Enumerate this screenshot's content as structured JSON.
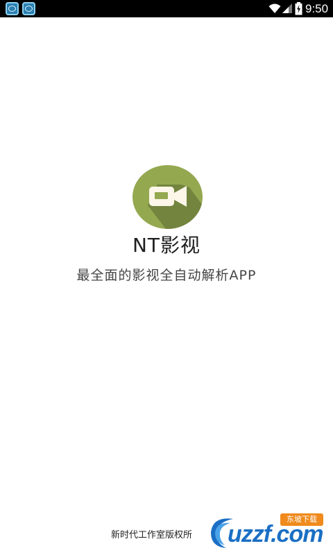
{
  "status_bar": {
    "time": "9:50",
    "icons": [
      "app-notification-icon",
      "app-notification-icon",
      "wifi-icon",
      "signal-icon",
      "battery-icon"
    ]
  },
  "splash": {
    "app_name": "NT影视",
    "tagline": "最全面的影视全自动解析APP",
    "logo_icon": "video-camera-icon",
    "logo_colors": {
      "circle": "#94a850",
      "shadow": "#6f7f3c",
      "camera": "#fbf6e8"
    }
  },
  "footer": {
    "copyright": "新时代工作室版权所"
  },
  "watermark": {
    "brand": "uzzf.com",
    "badge": "东坡下载"
  }
}
